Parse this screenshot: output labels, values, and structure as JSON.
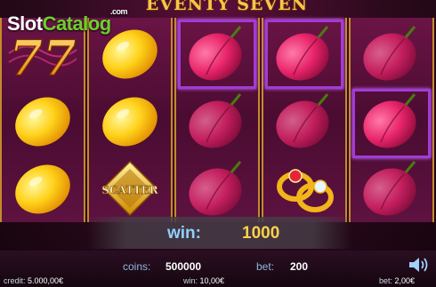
{
  "game": {
    "title": "EVENTY SEVEN",
    "watermark": {
      "slot": "Slot",
      "catalog": "Catalog",
      "com": ".com"
    }
  },
  "colors": {
    "plum": "#e8246a",
    "lemon": "#ffce1a",
    "highlight": "#a23bd6",
    "gold": "#f7c64a"
  },
  "reels": [
    {
      "symbols": [
        "seven-77-icon",
        "lemon-icon",
        "lemon-icon"
      ]
    },
    {
      "symbols": [
        "lemon-icon",
        "lemon-icon",
        "scatter-icon"
      ]
    },
    {
      "symbols": [
        "plum-icon",
        "plum-icon",
        "plum-icon"
      ]
    },
    {
      "symbols": [
        "plum-icon",
        "plum-icon",
        "ring-icon"
      ]
    },
    {
      "symbols": [
        "plum-icon",
        "plum-icon",
        "plum-icon"
      ]
    }
  ],
  "highlighted": [
    "reel-3-row-1",
    "reel-4-row-1",
    "reel-5-row-2"
  ],
  "scatter_text": "SCATTER",
  "seven_text": "77",
  "win": {
    "label": "win:",
    "value": "1000"
  },
  "panel": {
    "coins_label": "coins:",
    "coins_value": "500000",
    "bet_label": "bet:",
    "bet_value": "200",
    "credit_label": "credit:",
    "credit_value": "5.000,00€",
    "win_label": "win:",
    "win_value": "10,00€",
    "bet2_label": "bet:",
    "bet2_value": "2,00€"
  }
}
